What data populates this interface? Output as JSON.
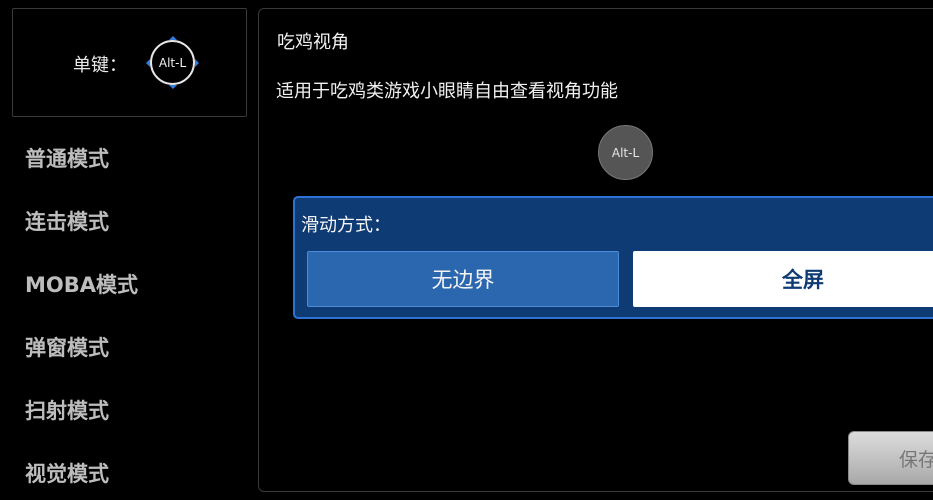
{
  "key_box": {
    "label": "单键：",
    "key_name": "Alt-L",
    "handle_color": "#2f7de0"
  },
  "modes": [
    {
      "label": "普通模式"
    },
    {
      "label": "连击模式"
    },
    {
      "label": "MOBA模式"
    },
    {
      "label": "弹窗模式"
    },
    {
      "label": "扫射模式"
    },
    {
      "label": "视觉模式"
    }
  ],
  "detail": {
    "title": "吃鸡视角",
    "description": "适用于吃鸡类游戏小眼睛自由查看视角功能",
    "preview_key": "Alt-L",
    "slide_mode": {
      "label": "滑动方式：",
      "options": [
        {
          "label": "无边界",
          "selected": false
        },
        {
          "label": "全屏",
          "selected": true
        }
      ]
    },
    "save_label": "保存"
  },
  "colors": {
    "background": "#000000",
    "panel_blue": "#0f3b74",
    "accent_blue": "#2d73d6",
    "option_blue": "#2a67ae"
  }
}
